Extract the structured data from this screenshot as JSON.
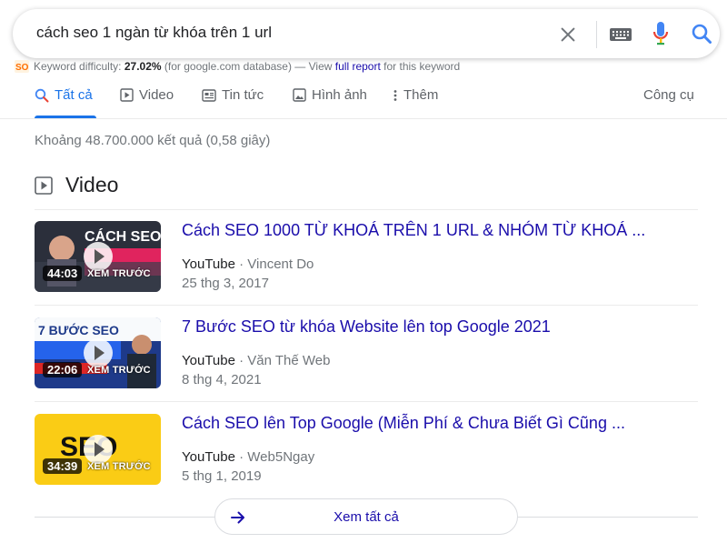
{
  "search": {
    "query": "cách seo 1 ngàn từ khóa trên 1 url"
  },
  "keyword_difficulty": {
    "label": "Keyword difficulty:",
    "value": "27.02%",
    "db_note": "(for google.com database) — View",
    "link": "full report",
    "suffix": "for this keyword"
  },
  "tabs": [
    {
      "label": "Tất cả",
      "icon": "search-icon",
      "active": true
    },
    {
      "label": "Video",
      "icon": "play-icon"
    },
    {
      "label": "Tin tức",
      "icon": "news-icon"
    },
    {
      "label": "Hình ảnh",
      "icon": "image-icon"
    },
    {
      "label": "Thêm",
      "icon": "more-vert-icon"
    }
  ],
  "tools_label": "Công cụ",
  "result_stats": "Khoảng 48.700.000 kết quả (0,58 giây)",
  "video_section": {
    "title": "Video",
    "items": [
      {
        "title": "Cách SEO 1000 TỪ KHOÁ TRÊN 1 URL & NHÓM TỪ KHOÁ ...",
        "source": "YouTube",
        "channel": "Vincent Do",
        "date": "25 thg 3, 2017",
        "duration": "44:03",
        "preview": "XEM TRƯỚC",
        "thumb_text": "CÁCH SEO"
      },
      {
        "title": "7 Bước SEO từ khóa Website lên top Google 2021",
        "source": "YouTube",
        "channel": "Văn Thế Web",
        "date": "8 thg 4, 2021",
        "duration": "22:06",
        "preview": "XEM TRƯỚC",
        "thumb_text": "7 BƯỚC SEO"
      },
      {
        "title": "Cách SEO lên Top Google (Miễn Phí & Chưa Biết Gì Cũng ...",
        "source": "YouTube",
        "channel": "Web5Ngay",
        "date": "5 thg 1, 2019",
        "duration": "34:39",
        "preview": "XEM TRƯỚC",
        "thumb_text": "SEO"
      }
    ],
    "see_all": "Xem tất cả"
  },
  "colors": {
    "link": "#1a0dab",
    "accent": "#1a73e8",
    "meta": "#70757a"
  }
}
